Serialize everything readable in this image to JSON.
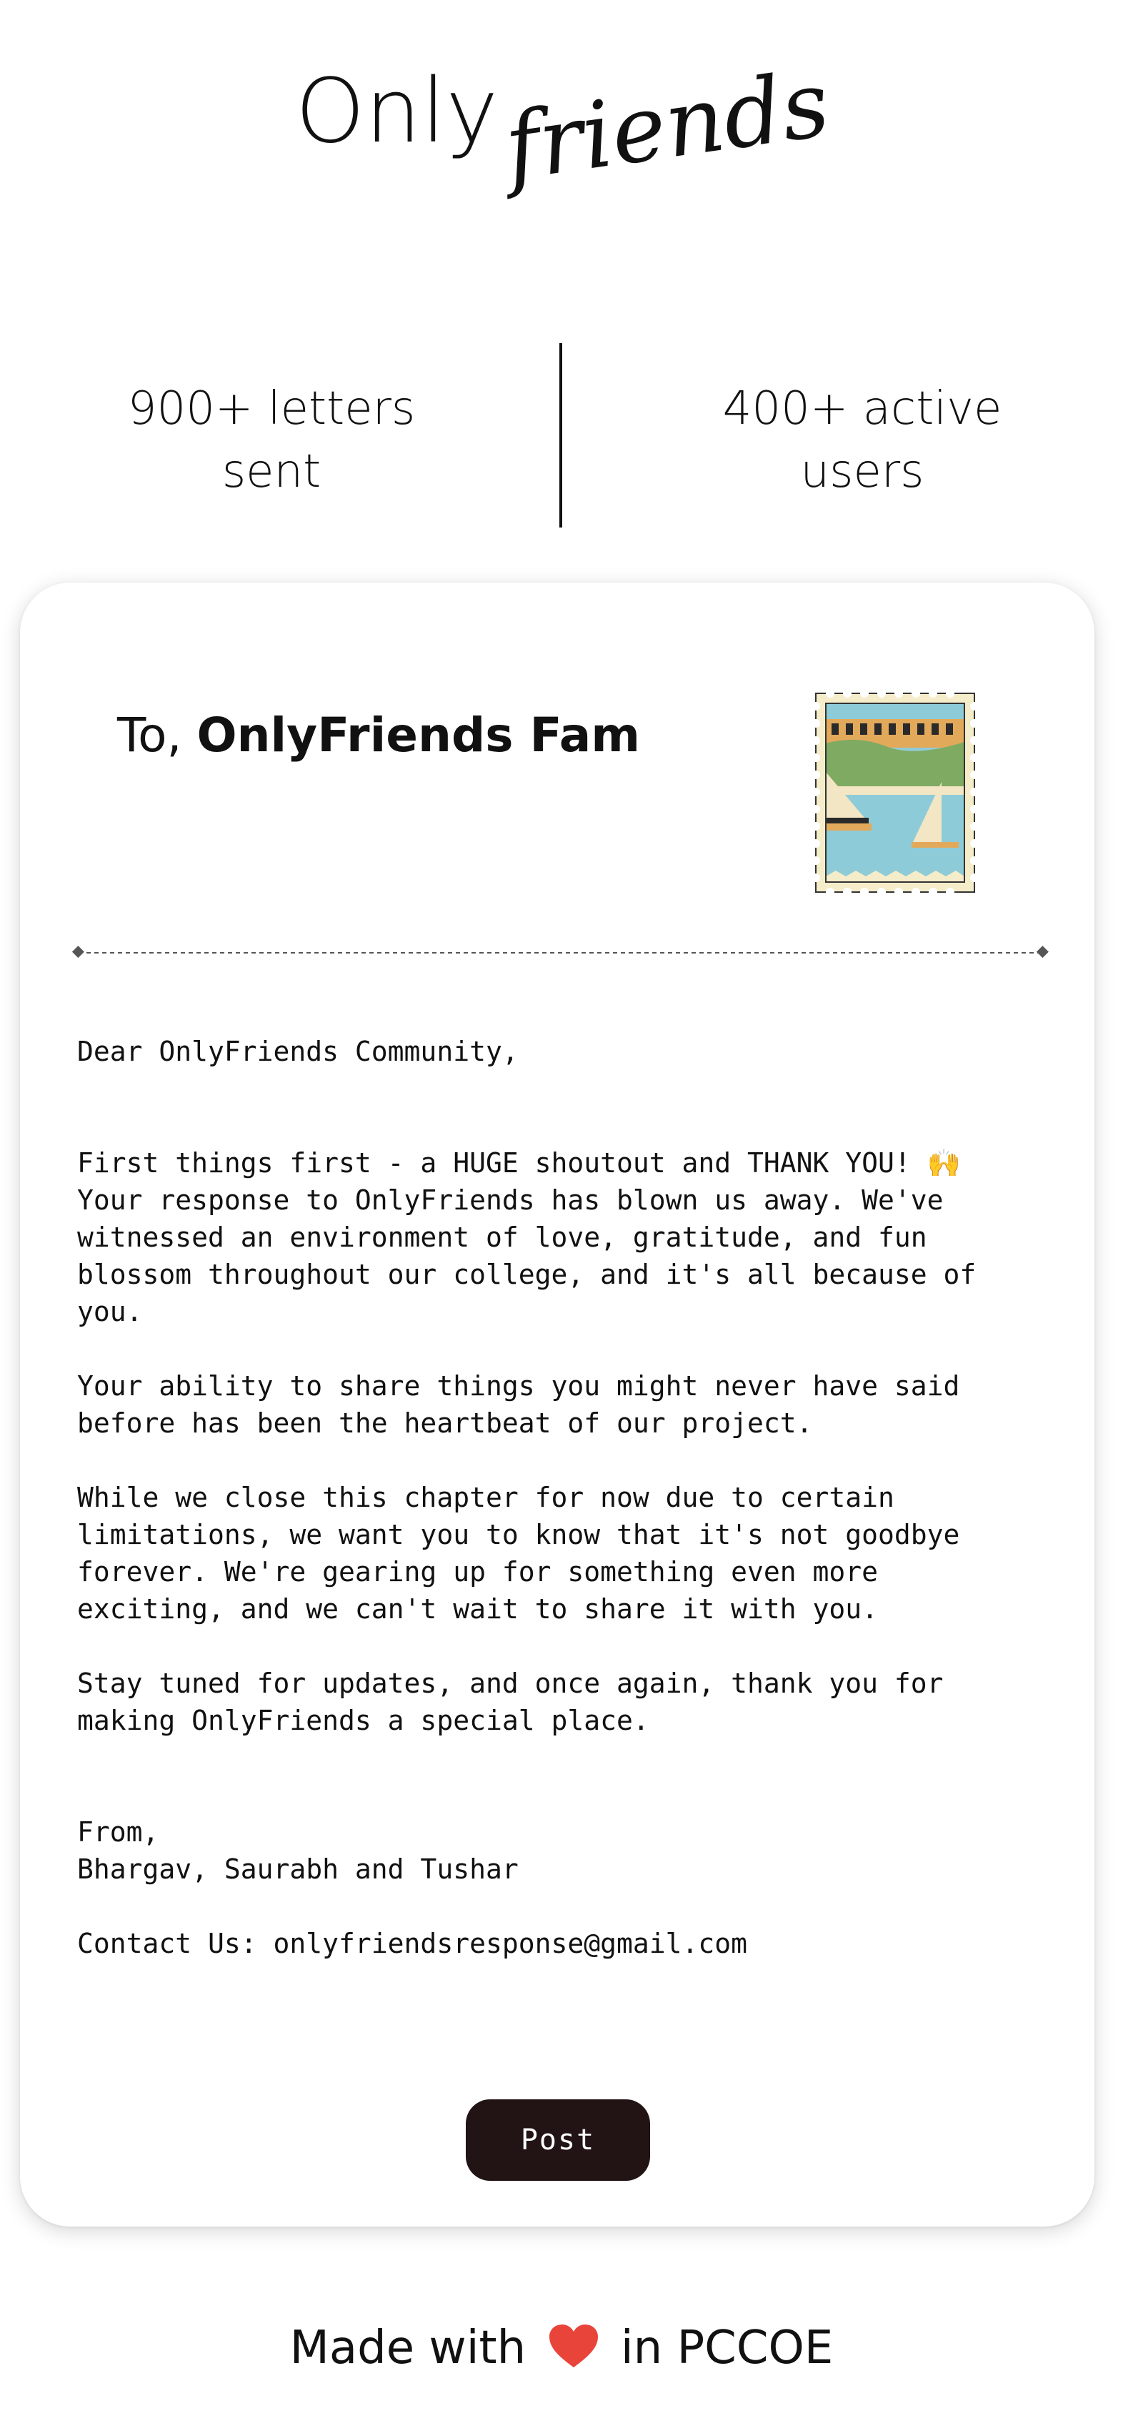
{
  "header": {
    "logo_main": "Only",
    "logo_script": "friends"
  },
  "stats": {
    "letters_line1": "900+ letters",
    "letters_line2": "sent",
    "users_line1": "400+ active",
    "users_line2": "users"
  },
  "letter": {
    "to_prefix": "To, ",
    "to_name": "OnlyFriends Fam",
    "stamp_icon": "postage-stamp-icon",
    "greeting": "Dear OnlyFriends Community,",
    "paragraph1": "First things first - a HUGE shoutout and THANK YOU! 🙌\nYour response to OnlyFriends has blown us away. We've\nwitnessed an environment of love, gratitude, and fun\nblossom throughout our college, and it's all because of\nyou.",
    "paragraph2": "Your ability to share things you might never have said\nbefore has been the heartbeat of our project.",
    "paragraph3": "While we close this chapter for now due to certain\nlimitations, we want you to know that it's not goodbye\nforever. We're gearing up for something even more\nexciting, and we can't wait to share it with you.",
    "paragraph4": "Stay tuned for updates, and once again, thank you for\nmaking OnlyFriends a special place.",
    "from_label": "From,",
    "signatories": "Bhargav, Saurabh and Tushar",
    "contact": "Contact Us: onlyfriendsresponse@gmail.com",
    "post_label": "Post"
  },
  "footer": {
    "made_with": "Made with",
    "heart_icon": "heart-icon",
    "in_place": "in PCCOE"
  },
  "colors": {
    "button_bg": "#221414",
    "heart": "#e8443a",
    "stamp_sky": "#8ecbd8",
    "stamp_grass": "#7faa62",
    "stamp_sand": "#e3a95b"
  }
}
